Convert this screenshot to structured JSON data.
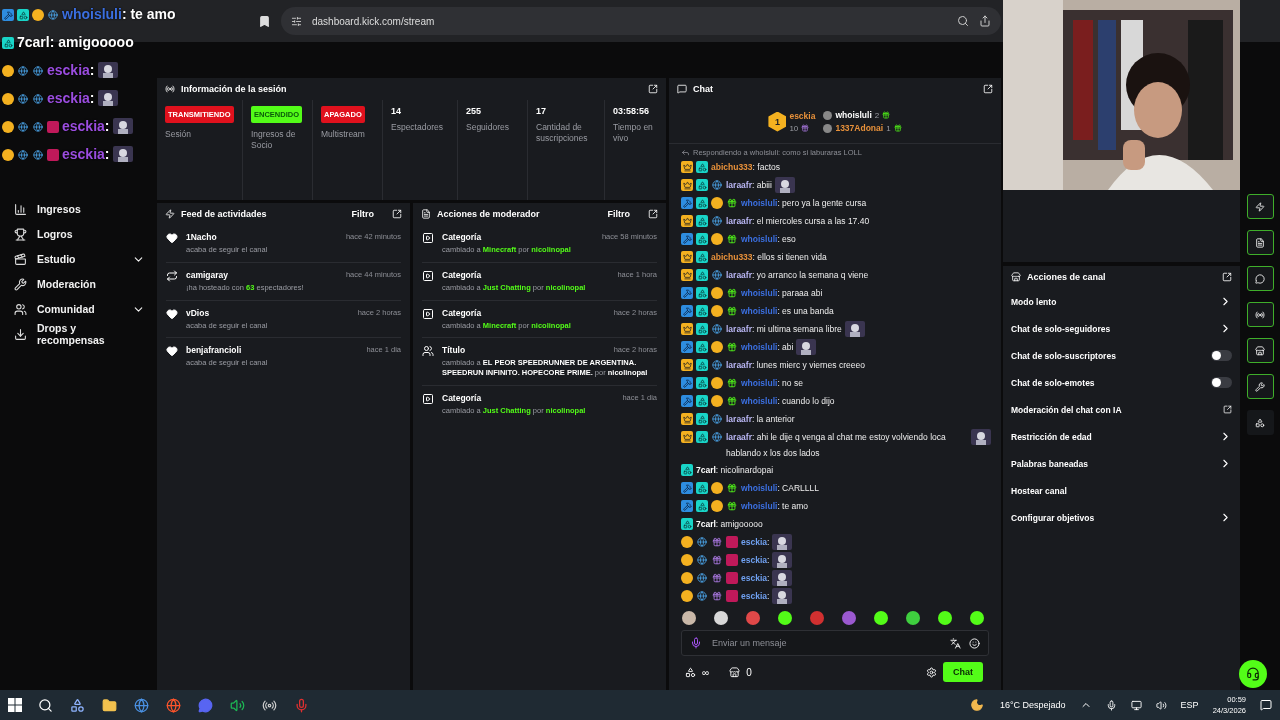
{
  "overlay_chat": [
    {
      "user": "whoisluli",
      "text": ": te amo",
      "color": "#3b6fe0",
      "badges": [
        {
          "kind": "mod"
        },
        {
          "kind": "og"
        },
        {
          "kind": "sub"
        },
        {
          "kind": "globe"
        }
      ]
    },
    {
      "user": "7carl",
      "text": ": amigooooo",
      "color": "#ffffff",
      "badges": [
        {
          "kind": "og"
        }
      ]
    },
    {
      "user": "esckia",
      "text": ":",
      "color": "#9b4de0",
      "badges": [
        {
          "kind": "sub"
        },
        {
          "kind": "globe"
        },
        {
          "kind": "globe"
        }
      ],
      "emote": true
    },
    {
      "user": "esckia",
      "text": ":",
      "color": "#9b4de0",
      "badges": [
        {
          "kind": "sub"
        },
        {
          "kind": "globe"
        },
        {
          "kind": "globe"
        }
      ],
      "emote": true
    },
    {
      "user": "esckia",
      "text": ":",
      "color": "#9b4de0",
      "badges": [
        {
          "kind": "sub"
        },
        {
          "kind": "globe"
        },
        {
          "kind": "globe"
        },
        {
          "kind": "tag"
        }
      ],
      "emote": true
    },
    {
      "user": "esckia",
      "text": ":",
      "color": "#9b4de0",
      "badges": [
        {
          "kind": "sub"
        },
        {
          "kind": "globe"
        },
        {
          "kind": "globe"
        },
        {
          "kind": "tag"
        }
      ],
      "emote": true
    }
  ],
  "browser": {
    "url": "dashboard.kick.com/stream"
  },
  "sidebar": {
    "items": [
      {
        "label": "Ingresos",
        "kind": "chart"
      },
      {
        "label": "Logros",
        "kind": "trophy"
      },
      {
        "label": "Estudio",
        "kind": "studio",
        "expanded": false
      },
      {
        "label": "Moderación",
        "kind": "wrench"
      },
      {
        "label": "Comunidad",
        "kind": "users",
        "expanded": false
      },
      {
        "label": "Drops y recompensas",
        "kind": "drops"
      }
    ]
  },
  "session": {
    "title": "Información de la sesión",
    "stats": [
      {
        "kind": "badge",
        "value": "TRANSMITIENDO",
        "color": "#e0111d",
        "label": "Sesión"
      },
      {
        "kind": "badge",
        "value": "ENCENDIDO",
        "color": "#53fc18",
        "label": "Ingresos de Socio"
      },
      {
        "kind": "badge",
        "value": "APAGADO",
        "color": "#e0111d",
        "label": "Multistream"
      },
      {
        "kind": "number",
        "value": "14",
        "label": "Espectadores"
      },
      {
        "kind": "number",
        "value": "255",
        "label": "Seguidores"
      },
      {
        "kind": "number",
        "value": "17",
        "label": "Cantidad de suscripciones"
      },
      {
        "kind": "number",
        "value": "03:58:56",
        "label": "Tiempo en vivo"
      }
    ]
  },
  "feed": {
    "title": "Feed de actividades",
    "filter": "Filtro",
    "items": [
      {
        "kind": "follow",
        "user": "1Nacho",
        "text": "acaba de seguir el canal",
        "time": "hace 42 minutos"
      },
      {
        "kind": "host",
        "user": "camigaray",
        "text": "¡ha hosteado con **63** espectadores!",
        "time": "hace 44 minutos"
      },
      {
        "kind": "follow",
        "user": "vDios",
        "text": "acaba de seguir el canal",
        "time": "hace 2 horas"
      },
      {
        "kind": "follow",
        "user": "benjafrancioli",
        "text": "acaba de seguir el canal",
        "time": "hace 1 dia"
      }
    ]
  },
  "mod_actions": {
    "title": "Acciones de moderador",
    "filter": "Filtro",
    "items": [
      {
        "kind": "category",
        "title": "Categoría",
        "text": "cambiado a **Minecraft** por **nicolinopal**",
        "time": "hace 58 minutos"
      },
      {
        "kind": "category",
        "title": "Categoría",
        "text": "cambiado a **Just Chatting** por **nicolinopal**",
        "time": "hace 1 hora"
      },
      {
        "kind": "category",
        "title": "Categoría",
        "text": "cambiado a **Minecraft** por **nicolinopal**",
        "time": "hace 2 horas"
      },
      {
        "kind": "title",
        "title": "Título",
        "text": "cambiado a **EL PEOR SPEEDRUNNER DE ARGENTINA. SPEEDRUN INFINITO. HOPECORE PRIME.** por **nicolinopal**",
        "time": "hace 2 horas"
      },
      {
        "kind": "category",
        "title": "Categoría",
        "text": "cambiado a **Just Chatting** por **nicolinopal**",
        "time": "hace 1 dia"
      }
    ]
  },
  "chat": {
    "title": "Chat",
    "leaders": [
      {
        "kind": "first",
        "rank": "1",
        "user": "esckia",
        "count": "10",
        "color": "#e8913a"
      },
      {
        "kind": "other",
        "user": "whoisluli",
        "count": "2",
        "color": "#ffffff"
      },
      {
        "kind": "other",
        "user": "1337Adonai",
        "count": "1",
        "color": "#e8913a"
      }
    ],
    "reply": "Respondiendo a whoisluli: como si laburaras LOLL",
    "messages": [
      {
        "badges": [
          {
            "kind": "crown"
          },
          {
            "kind": "og"
          }
        ],
        "user": "abichu333",
        "color": "#e8913a",
        "text": ": factos"
      },
      {
        "badges": [
          {
            "kind": "crown"
          },
          {
            "kind": "og"
          },
          {
            "kind": "globe"
          }
        ],
        "user": "laraafr",
        "color": "#b8b5f2",
        "text": ": abiii",
        "emote": true
      },
      {
        "badges": [
          {
            "kind": "mod"
          },
          {
            "kind": "og"
          },
          {
            "kind": "sub"
          },
          {
            "kind": "gift"
          }
        ],
        "user": "whoisluli",
        "color": "#3b6fe0",
        "text": ": pero ya la gente cursa"
      },
      {
        "badges": [
          {
            "kind": "crown"
          },
          {
            "kind": "og"
          },
          {
            "kind": "globe"
          }
        ],
        "user": "laraafr",
        "color": "#b8b5f2",
        "text": ": el miercoles cursa a las 17.40"
      },
      {
        "badges": [
          {
            "kind": "mod"
          },
          {
            "kind": "og"
          },
          {
            "kind": "sub"
          },
          {
            "kind": "gift"
          }
        ],
        "user": "whoisluli",
        "color": "#3b6fe0",
        "text": ": eso"
      },
      {
        "badges": [
          {
            "kind": "crown"
          },
          {
            "kind": "og"
          }
        ],
        "user": "abichu333",
        "color": "#e8913a",
        "text": ": ellos si tienen vida"
      },
      {
        "badges": [
          {
            "kind": "crown"
          },
          {
            "kind": "og"
          },
          {
            "kind": "globe"
          }
        ],
        "user": "laraafr",
        "color": "#b8b5f2",
        "text": ": yo arranco la semana q viene"
      },
      {
        "badges": [
          {
            "kind": "mod"
          },
          {
            "kind": "og"
          },
          {
            "kind": "sub"
          },
          {
            "kind": "gift"
          }
        ],
        "user": "whoisluli",
        "color": "#3b6fe0",
        "text": ": paraaa abi"
      },
      {
        "badges": [
          {
            "kind": "mod"
          },
          {
            "kind": "og"
          },
          {
            "kind": "sub"
          },
          {
            "kind": "gift"
          }
        ],
        "user": "whoisluli",
        "color": "#3b6fe0",
        "text": ": es una banda"
      },
      {
        "badges": [
          {
            "kind": "crown"
          },
          {
            "kind": "og"
          },
          {
            "kind": "globe"
          }
        ],
        "user": "laraafr",
        "color": "#b8b5f2",
        "text": ": mi ultima semana libre",
        "emote": true
      },
      {
        "badges": [
          {
            "kind": "mod"
          },
          {
            "kind": "og"
          },
          {
            "kind": "sub"
          },
          {
            "kind": "gift"
          }
        ],
        "user": "whoisluli",
        "color": "#3b6fe0",
        "text": ": abi",
        "emote": true
      },
      {
        "badges": [
          {
            "kind": "crown"
          },
          {
            "kind": "og"
          },
          {
            "kind": "globe"
          }
        ],
        "user": "laraafr",
        "color": "#b8b5f2",
        "text": ": lunes mierc y viernes creeeo"
      },
      {
        "badges": [
          {
            "kind": "mod"
          },
          {
            "kind": "og"
          },
          {
            "kind": "sub"
          },
          {
            "kind": "gift"
          }
        ],
        "user": "whoisluli",
        "color": "#3b6fe0",
        "text": ": no se"
      },
      {
        "badges": [
          {
            "kind": "mod"
          },
          {
            "kind": "og"
          },
          {
            "kind": "sub"
          },
          {
            "kind": "gift"
          }
        ],
        "user": "whoisluli",
        "color": "#3b6fe0",
        "text": ": cuando lo dijo"
      },
      {
        "badges": [
          {
            "kind": "crown"
          },
          {
            "kind": "og"
          },
          {
            "kind": "globe"
          }
        ],
        "user": "laraafr",
        "color": "#b8b5f2",
        "text": ": la anterior"
      },
      {
        "badges": [
          {
            "kind": "crown"
          },
          {
            "kind": "og"
          },
          {
            "kind": "globe"
          }
        ],
        "user": "laraafr",
        "color": "#b8b5f2",
        "text": ": ahi le dije q venga al chat me estoy volviendo loca hablando x los dos lados",
        "emote": true
      },
      {
        "badges": [
          {
            "kind": "og"
          }
        ],
        "user": "7carl",
        "color": "#ffffff",
        "text": ": nicolinardopai"
      },
      {
        "badges": [
          {
            "kind": "mod"
          },
          {
            "kind": "og"
          },
          {
            "kind": "sub"
          },
          {
            "kind": "gift"
          }
        ],
        "user": "whoisluli",
        "color": "#3b6fe0",
        "text": ": CARLLLL"
      },
      {
        "badges": [
          {
            "kind": "mod"
          },
          {
            "kind": "og"
          },
          {
            "kind": "sub"
          },
          {
            "kind": "gift"
          }
        ],
        "user": "whoisluli",
        "color": "#3b6fe0",
        "text": ": te amo"
      },
      {
        "badges": [
          {
            "kind": "og"
          }
        ],
        "user": "7carl",
        "color": "#ffffff",
        "text": ": amigooooo"
      },
      {
        "badges": [
          {
            "kind": "sub"
          },
          {
            "kind": "globe"
          },
          {
            "kind": "giftp"
          },
          {
            "kind": "tag"
          }
        ],
        "user": "esckia",
        "color": "#6fa0f0",
        "text": ":",
        "emote": true
      },
      {
        "badges": [
          {
            "kind": "sub"
          },
          {
            "kind": "globe"
          },
          {
            "kind": "giftp"
          },
          {
            "kind": "tag"
          }
        ],
        "user": "esckia",
        "color": "#6fa0f0",
        "text": ":",
        "emote": true
      },
      {
        "badges": [
          {
            "kind": "sub"
          },
          {
            "kind": "globe"
          },
          {
            "kind": "giftp"
          },
          {
            "kind": "tag"
          }
        ],
        "user": "esckia",
        "color": "#6fa0f0",
        "text": ":",
        "emote": true
      },
      {
        "badges": [
          {
            "kind": "sub"
          },
          {
            "kind": "globe"
          },
          {
            "kind": "giftp"
          },
          {
            "kind": "tag"
          }
        ],
        "user": "esckia",
        "color": "#6fa0f0",
        "text": ":",
        "emote": true
      }
    ],
    "emotes": [
      {
        "color": "#c9b8a8"
      },
      {
        "color": "#d8d8d8"
      },
      {
        "color": "#e04848"
      },
      {
        "color": "#53fc18"
      },
      {
        "color": "#d03030"
      },
      {
        "color": "#9b59d0"
      },
      {
        "color": "#53fc18"
      },
      {
        "color": "#3fcf3f"
      },
      {
        "color": "#53fc18"
      },
      {
        "color": "#53fc18"
      }
    ],
    "placeholder": "Enviar un mensaje",
    "points": "∞",
    "store_count": "0",
    "send": "Chat"
  },
  "channel_actions": {
    "title": "Acciones de canal",
    "items": [
      {
        "label": "Modo lento",
        "kind": "link"
      },
      {
        "label": "Chat de solo-seguidores",
        "kind": "link"
      },
      {
        "label": "Chat de solo-suscriptores",
        "kind": "toggle",
        "on": false
      },
      {
        "label": "Chat de solo-emotes",
        "kind": "toggle",
        "on": false
      },
      {
        "label": "Moderación del chat con IA",
        "kind": "external"
      },
      {
        "label": "Restricción de edad",
        "kind": "link"
      },
      {
        "label": "Palabras baneadas",
        "kind": "link"
      },
      {
        "label": "Hostear canal",
        "kind": "plain"
      },
      {
        "label": "Configurar objetivos",
        "kind": "link"
      }
    ]
  },
  "taskbar": {
    "weather": "16°C Despejado",
    "lang": "ESP",
    "time": "00:59",
    "date": "24/3/2026"
  }
}
